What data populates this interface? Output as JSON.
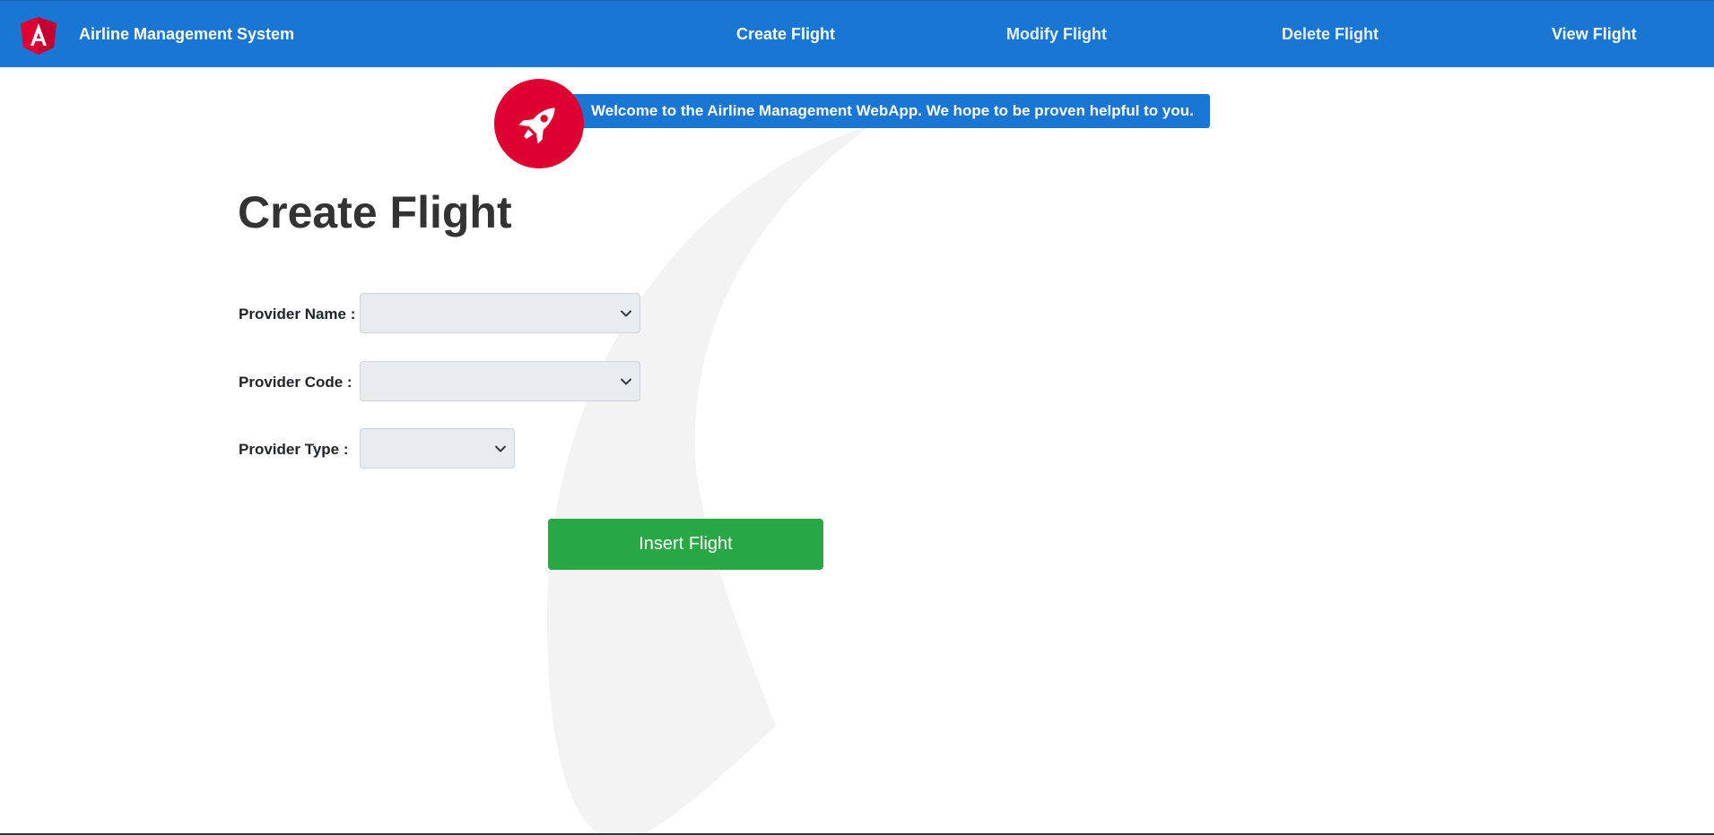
{
  "app": {
    "title": "Airline Management System",
    "logo_icon": "angular-logo-icon",
    "brand_color": "#1976d2",
    "logo_color": "#dd0031"
  },
  "nav": {
    "items": [
      {
        "label": "Create Flight",
        "active": true
      },
      {
        "label": "Modify Flight",
        "active": false
      },
      {
        "label": "Delete Flight",
        "active": false
      },
      {
        "label": "View Flight",
        "active": false
      }
    ]
  },
  "banner": {
    "icon": "rocket-icon",
    "text": "Welcome to the Airline Management WebApp. We hope to be proven helpful to you."
  },
  "form": {
    "title": "Create Flight",
    "fields": [
      {
        "label": "Provider Name :",
        "value": ""
      },
      {
        "label": "Provider Code :",
        "value": ""
      },
      {
        "label": "Provider Type :",
        "value": ""
      }
    ],
    "submit_label": "Insert Flight",
    "submit_color": "#28a745"
  }
}
